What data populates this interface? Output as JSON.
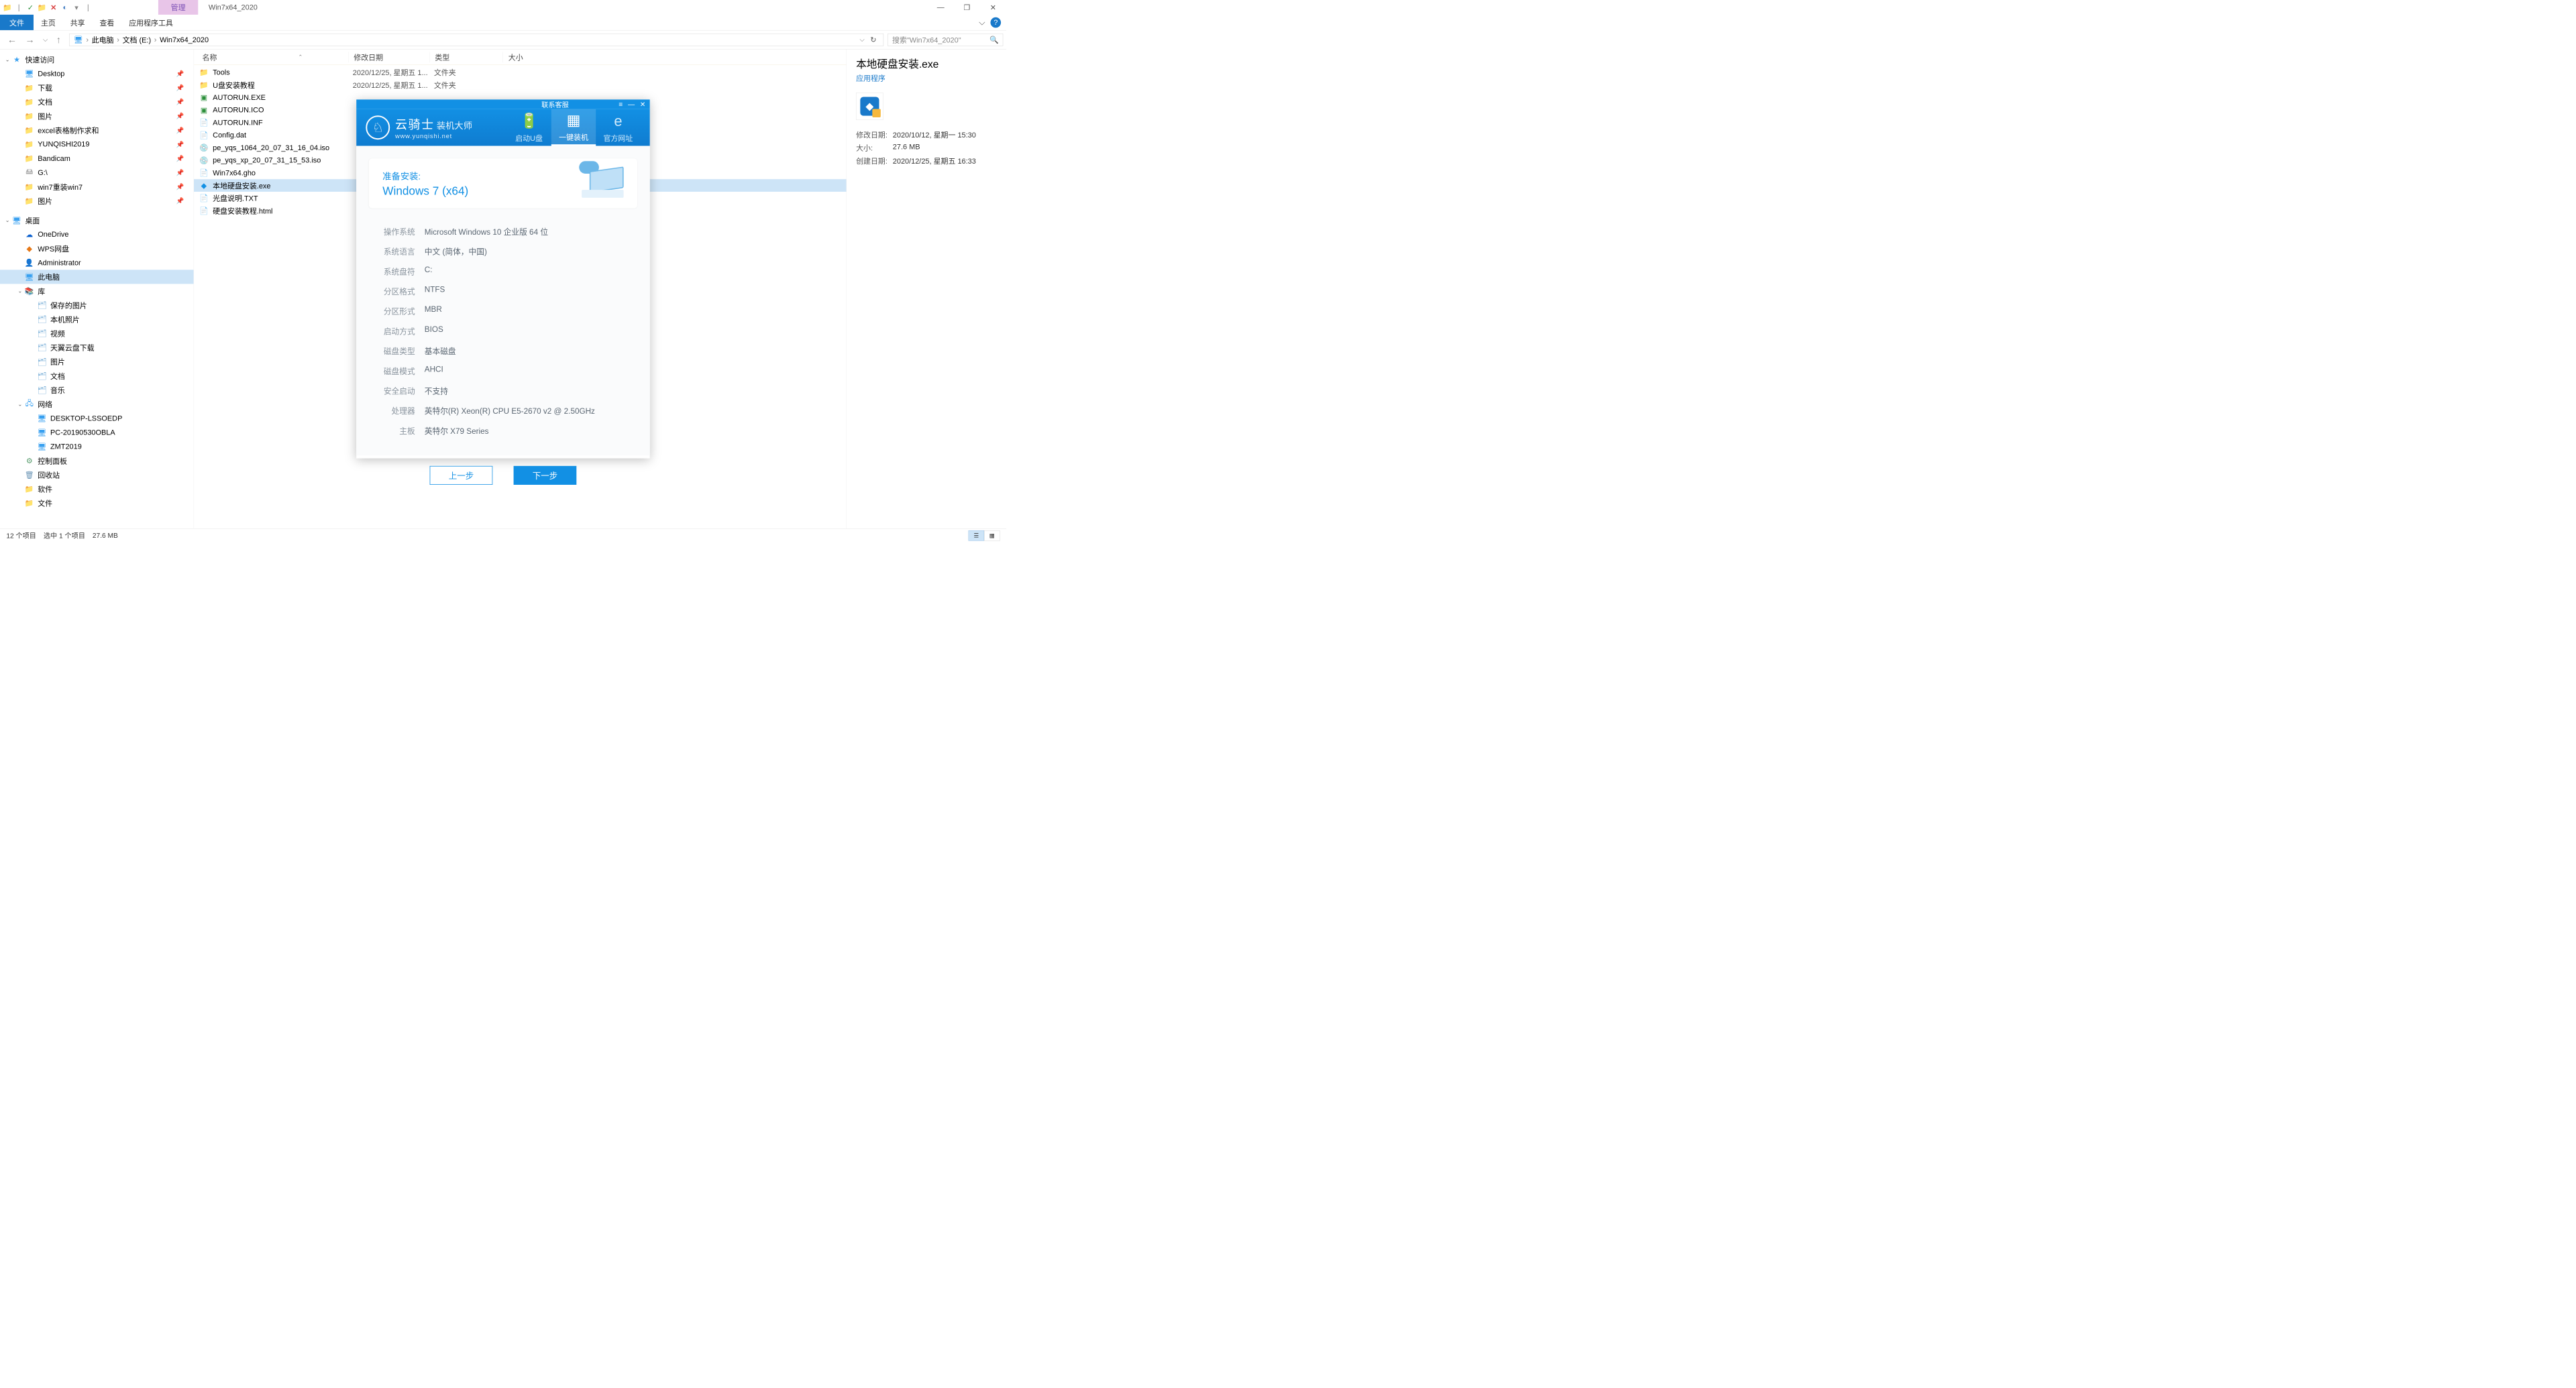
{
  "window": {
    "title": "Win7x64_2020",
    "manage_tab": "管理"
  },
  "ribbon": {
    "file": "文件",
    "home": "主页",
    "share": "共享",
    "view": "查看",
    "apptools": "应用程序工具"
  },
  "breadcrumb": {
    "thispc": "此电脑",
    "docs": "文档 (E:)",
    "folder": "Win7x64_2020"
  },
  "search": {
    "placeholder": "搜索\"Win7x64_2020\""
  },
  "sidebar": {
    "quick": "快速访问",
    "items_quick": [
      {
        "label": "Desktop"
      },
      {
        "label": "下载"
      },
      {
        "label": "文档"
      },
      {
        "label": "图片"
      },
      {
        "label": "excel表格制作求和"
      },
      {
        "label": "YUNQISHI2019"
      },
      {
        "label": "Bandicam"
      },
      {
        "label": "G:\\"
      },
      {
        "label": "win7重装win7"
      },
      {
        "label": "图片"
      }
    ],
    "desktop": "桌面",
    "items_desktop": [
      {
        "label": "OneDrive",
        "cls": "onedrive",
        "glyph": "☁"
      },
      {
        "label": "WPS网盘",
        "cls": "wps",
        "glyph": "◆"
      },
      {
        "label": "Administrator",
        "cls": "user",
        "glyph": "👤"
      },
      {
        "label": "此电脑",
        "cls": "monitor",
        "glyph": "🖥",
        "sel": true
      }
    ],
    "libs": "库",
    "items_libs": [
      {
        "label": "保存的图片"
      },
      {
        "label": "本机照片"
      },
      {
        "label": "视频"
      },
      {
        "label": "天翼云盘下载"
      },
      {
        "label": "图片"
      },
      {
        "label": "文档"
      },
      {
        "label": "音乐"
      }
    ],
    "network": "网络",
    "items_net": [
      {
        "label": "DESKTOP-LSSOEDP"
      },
      {
        "label": "PC-20190530OBLA"
      },
      {
        "label": "ZMT2019"
      }
    ],
    "cp": "控制面板",
    "recycle": "回收站",
    "software": "软件",
    "files": "文件"
  },
  "cols": {
    "name": "名称",
    "date": "修改日期",
    "type": "类型",
    "size": "大小"
  },
  "files": [
    {
      "ico": "folder",
      "name": "Tools",
      "date": "2020/12/25, 星期五 1...",
      "type": "文件夹"
    },
    {
      "ico": "folder",
      "name": "U盘安装教程",
      "date": "2020/12/25, 星期五 1...",
      "type": "文件夹"
    },
    {
      "ico": "exe-green",
      "name": "AUTORUN.EXE"
    },
    {
      "ico": "exe-green",
      "name": "AUTORUN.ICO"
    },
    {
      "ico": "inf",
      "name": "AUTORUN.INF"
    },
    {
      "ico": "file",
      "name": "Config.dat"
    },
    {
      "ico": "disc",
      "name": "pe_yqs_1064_20_07_31_16_04.iso"
    },
    {
      "ico": "disc",
      "name": "pe_yqs_xp_20_07_31_15_53.iso"
    },
    {
      "ico": "file",
      "name": "Win7x64.gho"
    },
    {
      "ico": "app-blue",
      "name": "本地硬盘安装.exe",
      "sel": true
    },
    {
      "ico": "txt",
      "name": "光盘说明.TXT"
    },
    {
      "ico": "html",
      "name": "硬盘安装教程.html"
    }
  ],
  "details": {
    "title": "本地硬盘安装.exe",
    "type": "应用程序",
    "props": [
      {
        "k": "修改日期:",
        "v": "2020/10/12, 星期一 15:30"
      },
      {
        "k": "大小:",
        "v": "27.6 MB"
      },
      {
        "k": "创建日期:",
        "v": "2020/12/25, 星期五 16:33"
      }
    ]
  },
  "status": {
    "count": "12 个项目",
    "sel": "选中 1 个项目",
    "size": "27.6 MB"
  },
  "dialog": {
    "contact": "联系客服",
    "brand": "云骑士",
    "brand2": "装机大师",
    "url": "www.yunqishi.net",
    "nav": [
      {
        "label": "启动U盘",
        "ico": "🔋"
      },
      {
        "label": "一键装机",
        "ico": "▦",
        "active": true
      },
      {
        "label": "官方网址",
        "ico": "e"
      }
    ],
    "prep": "准备安装:",
    "target": "Windows 7 (x64)",
    "info": [
      {
        "k": "操作系统",
        "v": "Microsoft Windows 10 企业版 64 位"
      },
      {
        "k": "系统语言",
        "v": "中文 (简体，中国)"
      },
      {
        "k": "系统盘符",
        "v": "C:"
      },
      {
        "k": "分区格式",
        "v": "NTFS"
      },
      {
        "k": "分区形式",
        "v": "MBR"
      },
      {
        "k": "启动方式",
        "v": "BIOS"
      },
      {
        "k": "磁盘类型",
        "v": "基本磁盘"
      },
      {
        "k": "磁盘模式",
        "v": "AHCI"
      },
      {
        "k": "安全启动",
        "v": "不支持"
      },
      {
        "k": "处理器",
        "v": "英特尔(R) Xeon(R) CPU E5-2670 v2 @ 2.50GHz"
      },
      {
        "k": "主板",
        "v": "英特尔 X79 Series"
      }
    ],
    "prev": "上一步",
    "next": "下一步"
  }
}
